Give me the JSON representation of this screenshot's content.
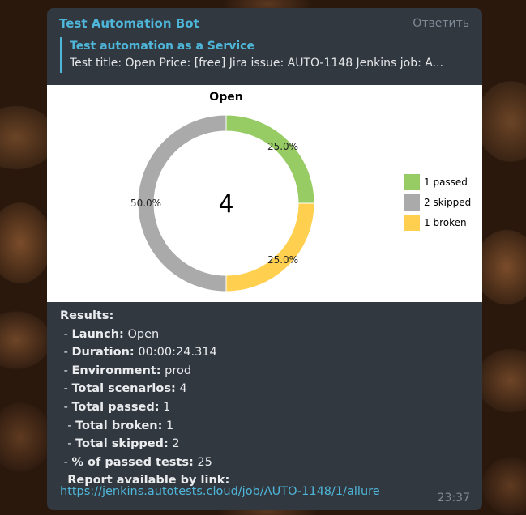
{
  "message": {
    "sender": "Test Automation Bot",
    "reply_label": "Ответить",
    "time": "23:37"
  },
  "quote": {
    "title": "Test automation as a Service",
    "text": "Test title: Open Price: [free] Jira issue: AUTO-1148 Jenkins job: A..."
  },
  "chart_data": {
    "type": "pie",
    "title": "Open",
    "center_label": "4",
    "slices": [
      {
        "label": "1 passed",
        "value": 1,
        "percent_label": "25.0%",
        "color": "#97cc64"
      },
      {
        "label": "1 broken",
        "value": 1,
        "percent_label": "25.0%",
        "color": "#ffd050"
      },
      {
        "label": "2 skipped",
        "value": 2,
        "percent_label": "50.0%",
        "color": "#aaaaaa"
      }
    ],
    "legend_order": [
      "1 passed",
      "2 skipped",
      "1 broken"
    ],
    "legend": "right"
  },
  "results": {
    "heading": "Results:",
    "launch_label": "Launch:",
    "launch_value": "Open",
    "duration_label": "Duration:",
    "duration_value": "00:00:24.314",
    "environment_label": "Environment:",
    "environment_value": "prod",
    "total_scenarios_label": "Total scenarios:",
    "total_scenarios_value": "4",
    "total_passed_label": "Total passed:",
    "total_passed_value": "1",
    "total_broken_label": "Total broken:",
    "total_broken_value": "1",
    "total_skipped_label": "Total skipped:",
    "total_skipped_value": "2",
    "percent_passed_label": "% of passed tests:",
    "percent_passed_value": "25",
    "report_label": "Report available by link:",
    "report_link": "https://jenkins.autotests.cloud/job/AUTO-1148/1/allure"
  }
}
